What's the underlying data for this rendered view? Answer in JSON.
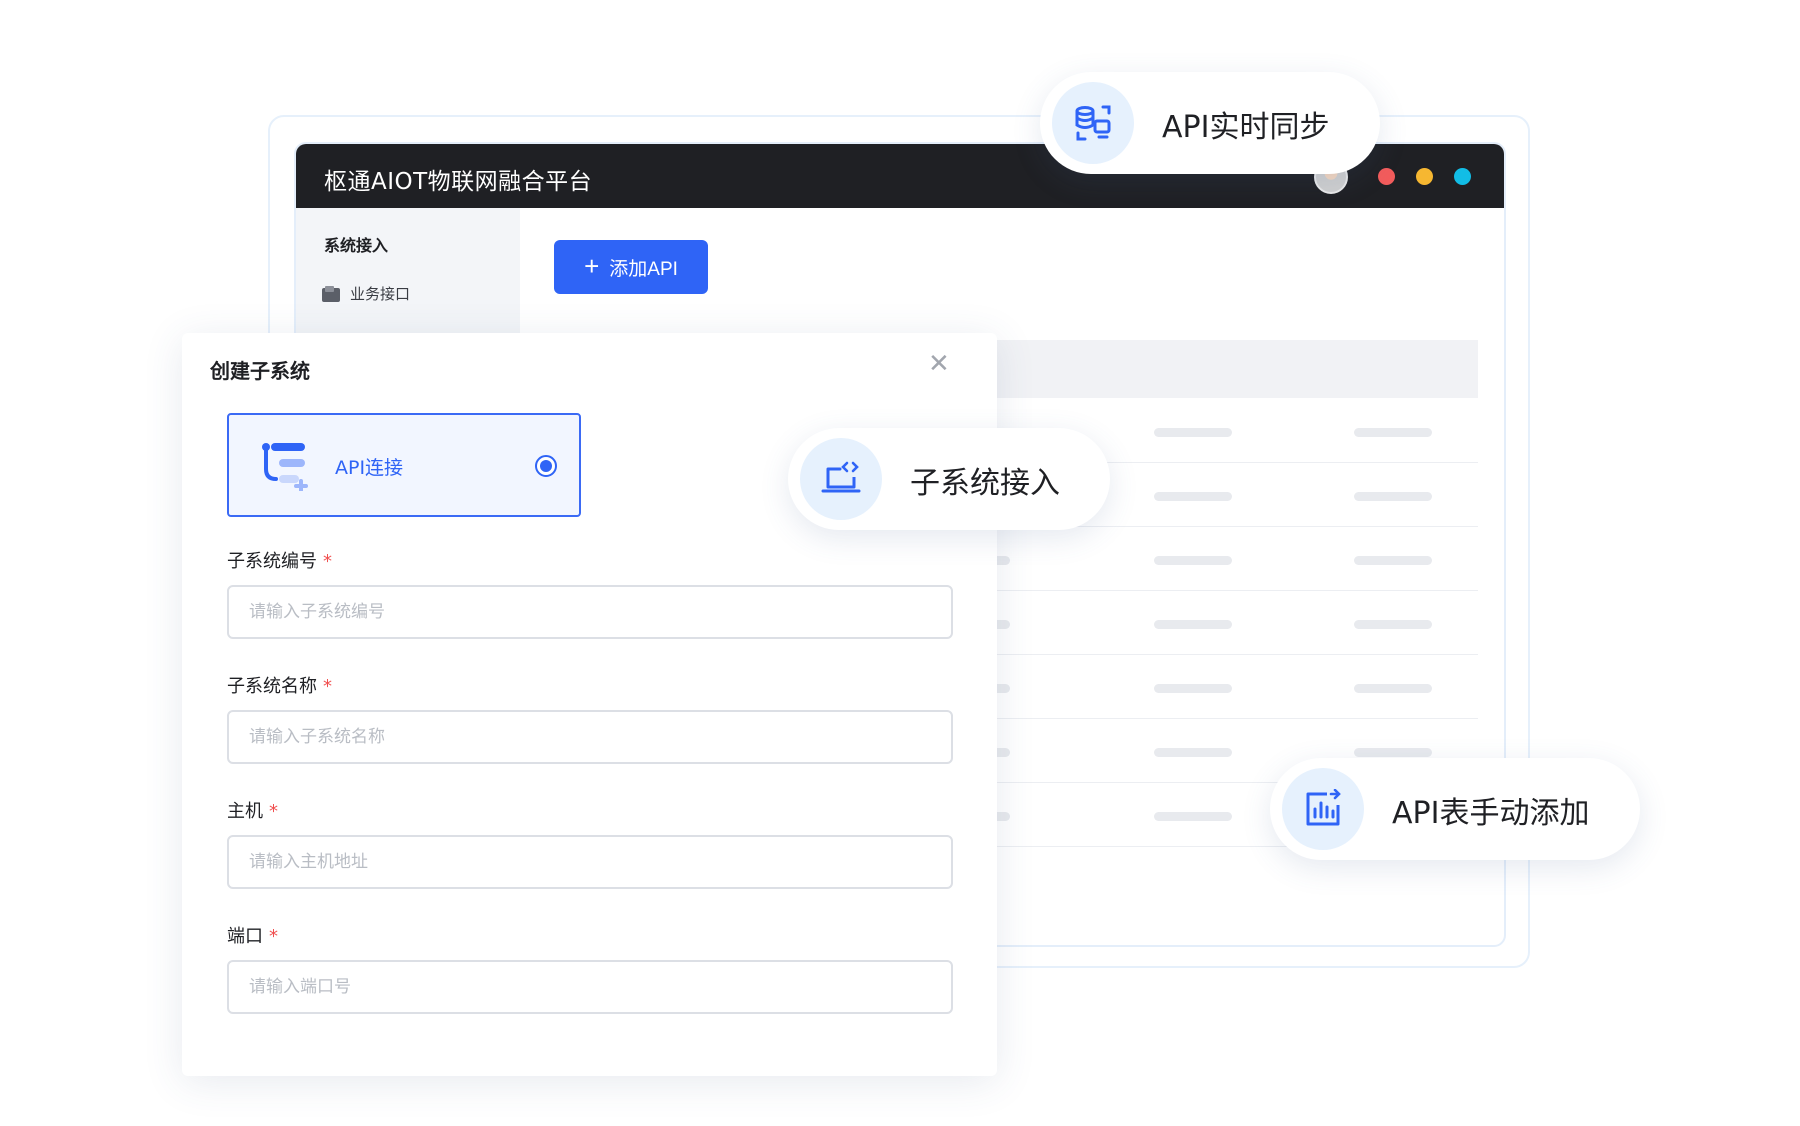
{
  "app": {
    "title": "枢通AIOT物联网融合平台"
  },
  "sidebar": {
    "section_label": "系统接入",
    "items": [
      {
        "label": "业务接口"
      }
    ]
  },
  "toolbar": {
    "add_api_label": "添加API"
  },
  "modal": {
    "title": "创建子系统",
    "option": {
      "label": "API连接",
      "selected": true
    },
    "fields": [
      {
        "label": "子系统编号",
        "required_mark": "*",
        "placeholder": "请输入子系统编号",
        "value": ""
      },
      {
        "label": "子系统名称",
        "required_mark": "*",
        "placeholder": "请输入子系统名称",
        "value": ""
      },
      {
        "label": "主机",
        "required_mark": "*",
        "placeholder": "请输入主机地址",
        "value": ""
      },
      {
        "label": "端口",
        "required_mark": "*",
        "placeholder": "请输入端口号",
        "value": ""
      }
    ]
  },
  "features": [
    {
      "label": "API实时同步",
      "icon": "database-sync-icon"
    },
    {
      "label": "子系统接入",
      "icon": "laptop-code-icon"
    },
    {
      "label": "API表手动添加",
      "icon": "bar-chart-icon"
    }
  ],
  "colors": {
    "accent": "#2f64f6",
    "titlebar": "#1f2024",
    "required": "#f04f4f",
    "icon_bg": "#e6f1fd"
  }
}
